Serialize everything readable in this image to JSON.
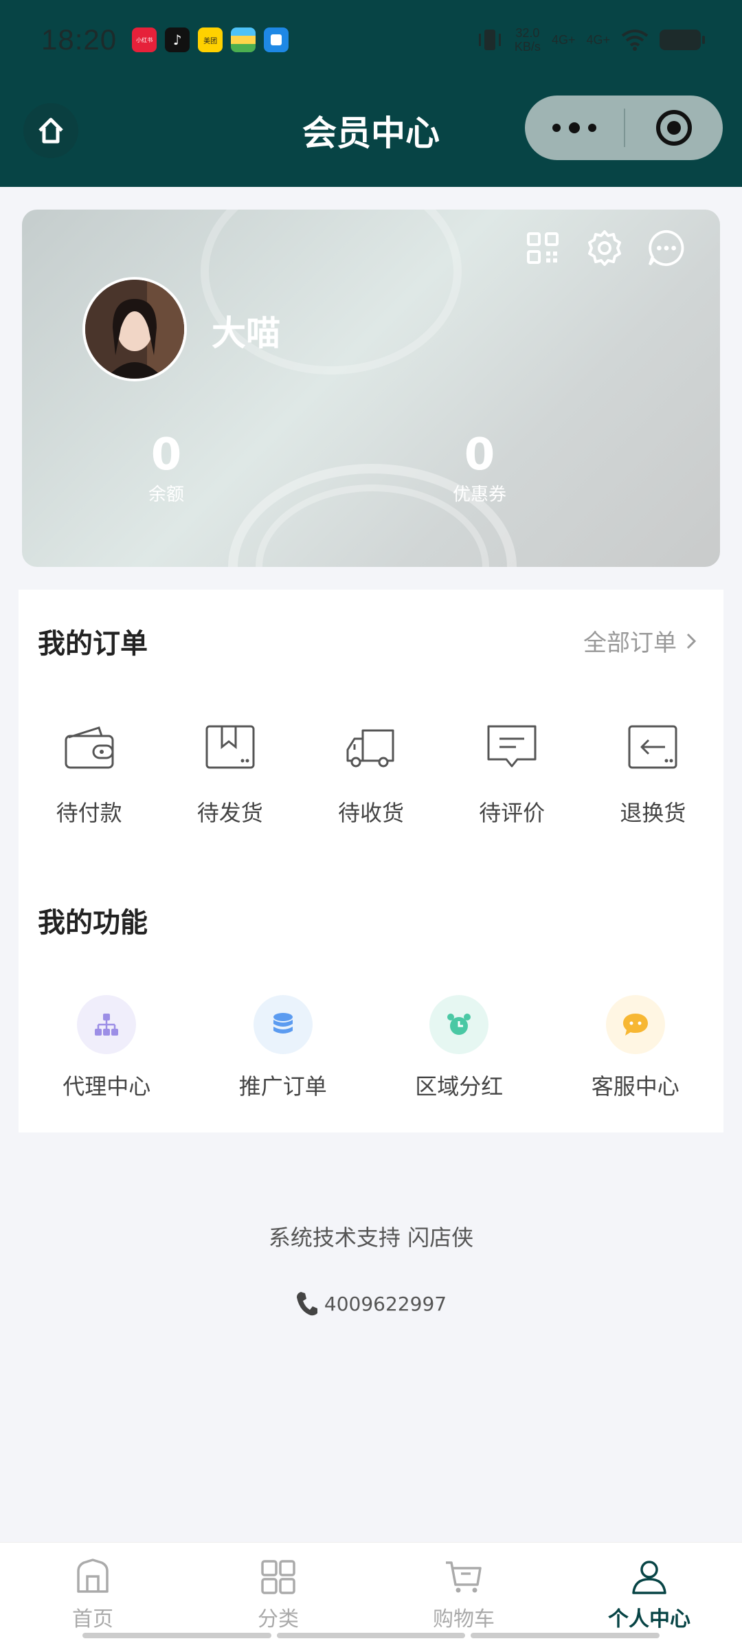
{
  "status_bar": {
    "time": "18:20",
    "apps": [
      "小红书",
      "抖音",
      "美团",
      "钱包",
      "文件"
    ],
    "net_speed": "32.0",
    "net_unit": "KB/s",
    "signal1": "4G+",
    "signal2": "4G+"
  },
  "header": {
    "title": "会员中心"
  },
  "profile": {
    "username": "大喵",
    "balance_value": "0",
    "balance_label": "余额",
    "coupon_value": "0",
    "coupon_label": "优惠券"
  },
  "orders": {
    "title": "我的订单",
    "all_link": "全部订单",
    "items": [
      {
        "label": "待付款",
        "icon": "wallet-icon"
      },
      {
        "label": "待发货",
        "icon": "box-icon"
      },
      {
        "label": "待收货",
        "icon": "truck-icon"
      },
      {
        "label": "待评价",
        "icon": "comment-icon"
      },
      {
        "label": "退换货",
        "icon": "return-icon"
      }
    ]
  },
  "functions": {
    "title": "我的功能",
    "items": [
      {
        "label": "代理中心",
        "icon": "org-chart-icon",
        "color": "#f0eefb"
      },
      {
        "label": "推广订单",
        "icon": "database-icon",
        "color": "#eaf3fc"
      },
      {
        "label": "区域分红",
        "icon": "alarm-clock-icon",
        "color": "#e6f7f2"
      },
      {
        "label": "客服中心",
        "icon": "chat-bubble-icon",
        "color": "#fff6e3"
      }
    ]
  },
  "footer": {
    "support": "系统技术支持 闪店侠",
    "phone": "4009622997"
  },
  "tabbar": {
    "items": [
      {
        "label": "首页",
        "icon": "home-icon"
      },
      {
        "label": "分类",
        "icon": "grid-icon"
      },
      {
        "label": "购物车",
        "icon": "cart-icon"
      },
      {
        "label": "个人中心",
        "icon": "person-icon"
      }
    ],
    "active_index": 3
  },
  "colors": {
    "brand": "#074445",
    "background": "#f4f5f9"
  }
}
